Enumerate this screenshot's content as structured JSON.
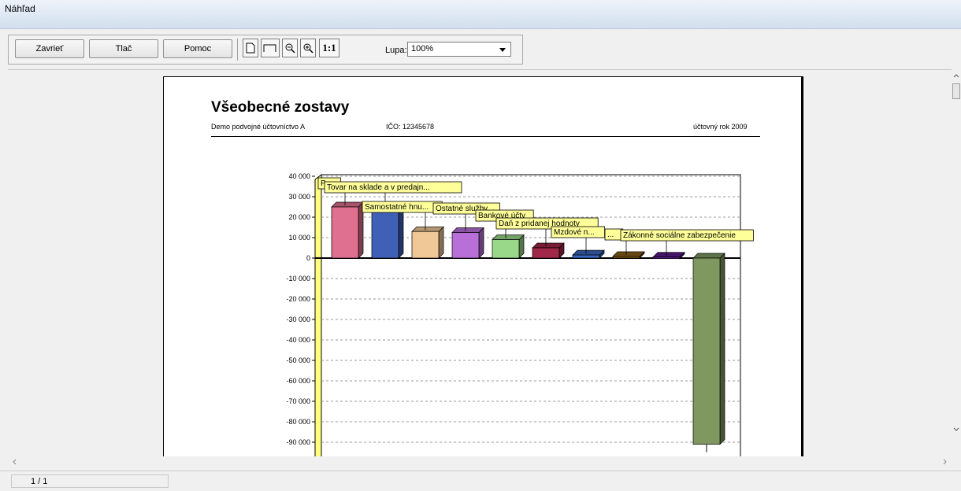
{
  "window": {
    "title": "Náhľad"
  },
  "toolbar": {
    "close_label": "Zavrieť",
    "print_label": "Tlač",
    "help_label": "Pomoc",
    "actual_size_label": "1:1",
    "zoom_label": "Lupa:",
    "zoom_value": "100%"
  },
  "report": {
    "title": "Všeobecné zostavy",
    "company": "Demo podvojné účtovníctvo A",
    "ico": "IČO: 12345678",
    "year": "účtovný rok 2009"
  },
  "status": {
    "page": "1 / 1"
  },
  "chart_data": {
    "type": "bar",
    "ylim": [
      -95000,
      45000
    ],
    "y_ticks": [
      40000,
      30000,
      20000,
      10000,
      0,
      -10000,
      -20000,
      -30000,
      -40000,
      -50000,
      -60000,
      -70000,
      -80000,
      -90000
    ],
    "y_tick_labels": [
      "40 000",
      "30 000",
      "20 000",
      "10 000",
      "0",
      "-10 000",
      "-20 000",
      "-30 000",
      "-40 000",
      "-50 000",
      "-60 000",
      "-70 000",
      "-80 000",
      "-90 000"
    ],
    "grid": true,
    "bars": [
      {
        "label": "P...",
        "value": 25000,
        "color": "#e07090"
      },
      {
        "label": "Tovar na sklade a v predajn...",
        "value": 23000,
        "color": "#4060b8"
      },
      {
        "label": "Samostatné hnu...",
        "value": 13000,
        "color": "#f0c898"
      },
      {
        "label": "Ostatné služby",
        "value": 12500,
        "color": "#b870d8"
      },
      {
        "label": "Bankové účty",
        "value": 9000,
        "color": "#98d888"
      },
      {
        "label": "Daň z pridanej hodnoty",
        "value": 5000,
        "color": "#a02848"
      },
      {
        "label": "Mzdové n...",
        "value": 1500,
        "color": "#3a68c0"
      },
      {
        "label": "...",
        "value": 800,
        "color": "#8a6018"
      },
      {
        "label": "Zákonné sociálne zabezpečenie",
        "value": 500,
        "color": "#5a1a8a"
      },
      {
        "label": "",
        "value": -91000,
        "color": "#7e9860"
      }
    ]
  }
}
